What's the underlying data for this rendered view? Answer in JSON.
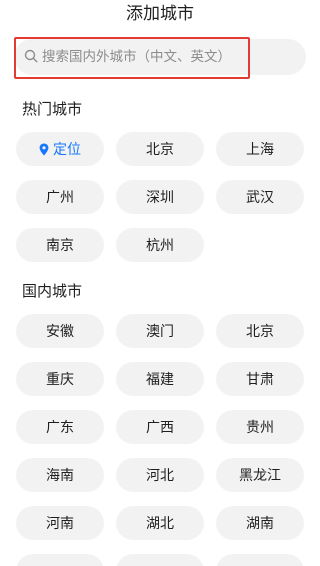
{
  "header": {
    "title": "添加城市"
  },
  "search": {
    "placeholder": "搜索国内外城市（中文、英文）",
    "value": ""
  },
  "hot_cities": {
    "title": "热门城市",
    "locate_label": "定位",
    "items": [
      "北京",
      "上海",
      "广州",
      "深圳",
      "武汉",
      "南京",
      "杭州"
    ]
  },
  "domestic_cities": {
    "title": "国内城市",
    "items": [
      "安徽",
      "澳门",
      "北京",
      "重庆",
      "福建",
      "甘肃",
      "广东",
      "广西",
      "贵州",
      "海南",
      "河北",
      "黑龙江",
      "河南",
      "湖北",
      "湖南"
    ]
  },
  "colors": {
    "accent": "#1677ff",
    "chip_bg": "#f2f2f2",
    "highlight_border": "#e53935"
  }
}
